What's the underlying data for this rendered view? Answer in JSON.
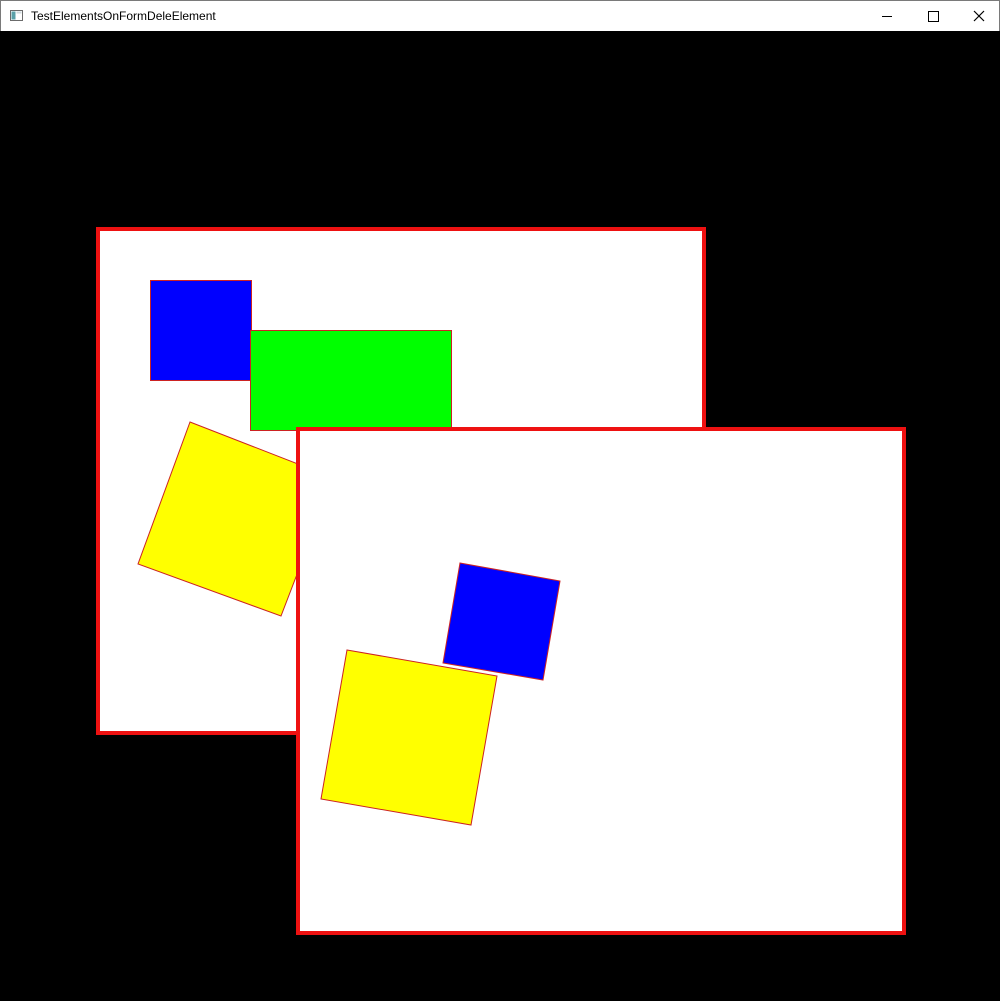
{
  "window": {
    "title": "TestElementsOnFormDeleElement",
    "icons": {
      "app": "app-window-icon",
      "minimize": "minimize-icon",
      "maximize": "maximize-icon",
      "close": "close-icon"
    }
  },
  "canvas": {
    "background": "#000000",
    "panel_fill": "#ffffff",
    "panel_border": "#ee1111",
    "shape_outline": "#cc2222",
    "colors": {
      "blue": "#0000ff",
      "green": "#00ff00",
      "yellow": "#ffff00"
    }
  }
}
